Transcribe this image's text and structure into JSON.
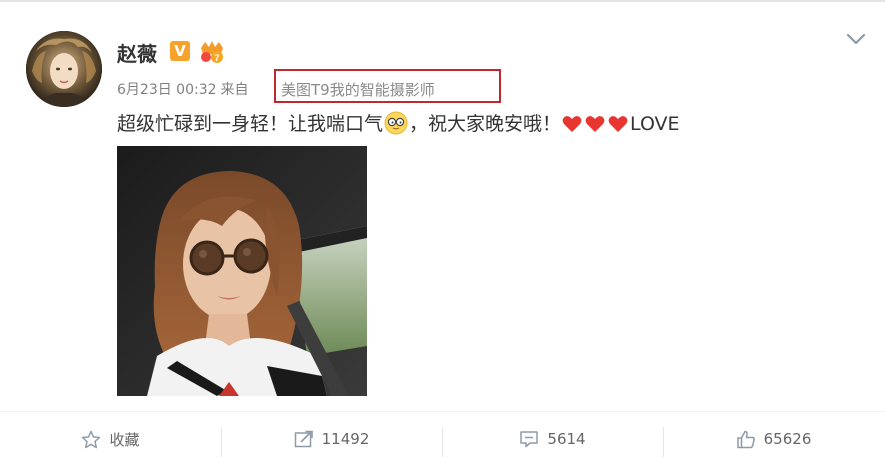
{
  "post": {
    "author": "赵薇",
    "vip_label": "V",
    "time": "6月23日 00:32",
    "from_label": "来自",
    "source": "美图T9我的智能摄影师",
    "text_before": "超级忙碌到一身轻！让我喘口气",
    "text_after": "，祝大家晚安哦！",
    "love": "LOVE"
  },
  "actions": {
    "favorite": "收藏",
    "repost": "11492",
    "comment": "5614",
    "like": "65626"
  },
  "colors": {
    "highlight_border": "#c0282f",
    "vip": "#f7a22c",
    "heart": "#e8352f"
  }
}
